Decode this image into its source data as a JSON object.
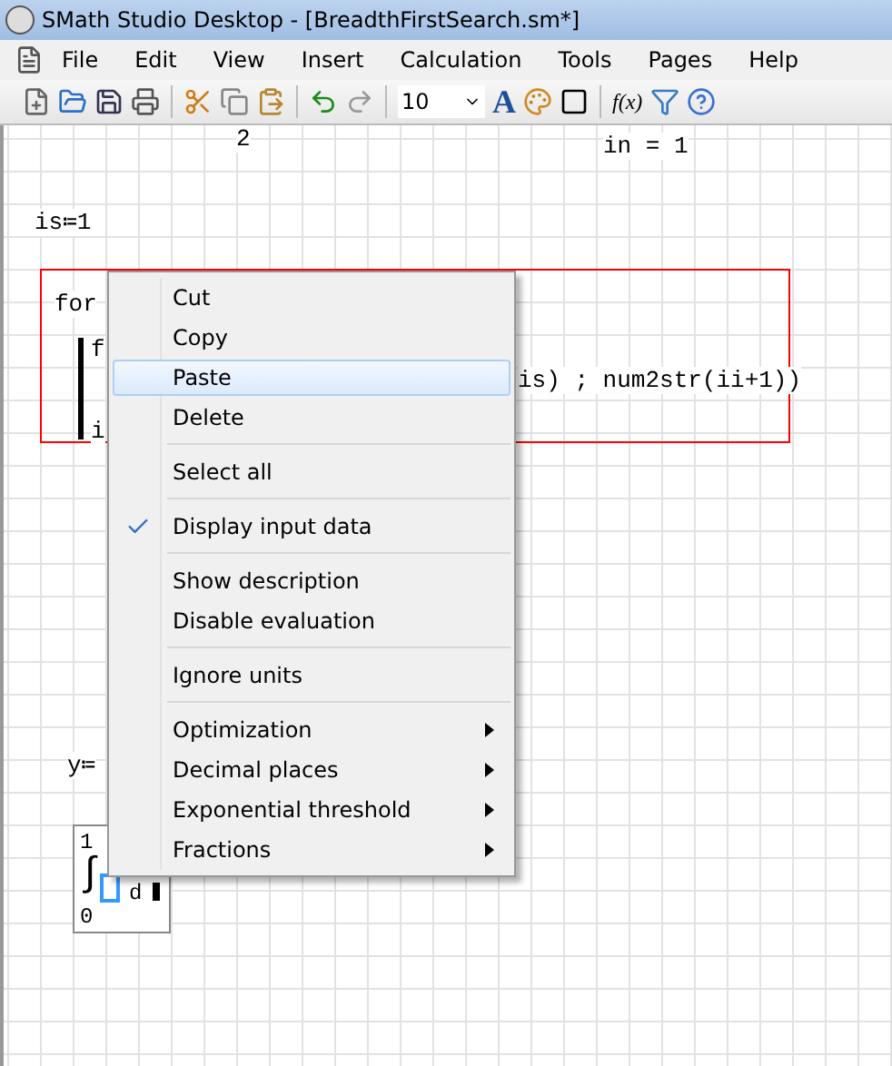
{
  "window": {
    "title": "SMath Studio Desktop - [BreadthFirstSearch.sm*]"
  },
  "menu": [
    "File",
    "Edit",
    "View",
    "Insert",
    "Calculation",
    "Tools",
    "Pages",
    "Help"
  ],
  "toolbar": {
    "font_size": "10",
    "font_color_label": "A",
    "function_label": "f(x)"
  },
  "canvas": {
    "items": [
      {
        "kind": "text",
        "text": "2"
      },
      {
        "kind": "text",
        "text": "in = 1"
      },
      {
        "kind": "text",
        "text": "is≔1"
      },
      {
        "kind": "text",
        "text": "for"
      },
      {
        "kind": "text",
        "text": "f"
      },
      {
        "kind": "text",
        "text": "is) ; num2str(ii+1))"
      },
      {
        "kind": "text",
        "text": "i"
      },
      {
        "kind": "text",
        "text": "y≔"
      }
    ],
    "integral": {
      "upper": "1",
      "lower": "0",
      "symbol": "∫",
      "variable": "d"
    }
  },
  "context_menu": [
    {
      "kind": "item",
      "label": "Cut",
      "selected": false,
      "checked": false,
      "submenu": false
    },
    {
      "kind": "item",
      "label": "Copy",
      "selected": false,
      "checked": false,
      "submenu": false
    },
    {
      "kind": "item",
      "label": "Paste",
      "selected": true,
      "checked": false,
      "submenu": false
    },
    {
      "kind": "item",
      "label": "Delete",
      "selected": false,
      "checked": false,
      "submenu": false
    },
    {
      "kind": "separator"
    },
    {
      "kind": "item",
      "label": "Select all",
      "selected": false,
      "checked": false,
      "submenu": false
    },
    {
      "kind": "separator"
    },
    {
      "kind": "item",
      "label": "Display input data",
      "selected": false,
      "checked": true,
      "submenu": false
    },
    {
      "kind": "separator"
    },
    {
      "kind": "item",
      "label": "Show description",
      "selected": false,
      "checked": false,
      "submenu": false
    },
    {
      "kind": "item",
      "label": "Disable evaluation",
      "selected": false,
      "checked": false,
      "submenu": false
    },
    {
      "kind": "separator"
    },
    {
      "kind": "item",
      "label": "Ignore units",
      "selected": false,
      "checked": false,
      "submenu": false
    },
    {
      "kind": "separator"
    },
    {
      "kind": "item",
      "label": "Optimization",
      "selected": false,
      "checked": false,
      "submenu": true
    },
    {
      "kind": "item",
      "label": "Decimal places",
      "selected": false,
      "checked": false,
      "submenu": true
    },
    {
      "kind": "item",
      "label": "Exponential threshold",
      "selected": false,
      "checked": false,
      "submenu": true
    },
    {
      "kind": "item",
      "label": "Fractions",
      "selected": false,
      "checked": false,
      "submenu": true
    }
  ]
}
